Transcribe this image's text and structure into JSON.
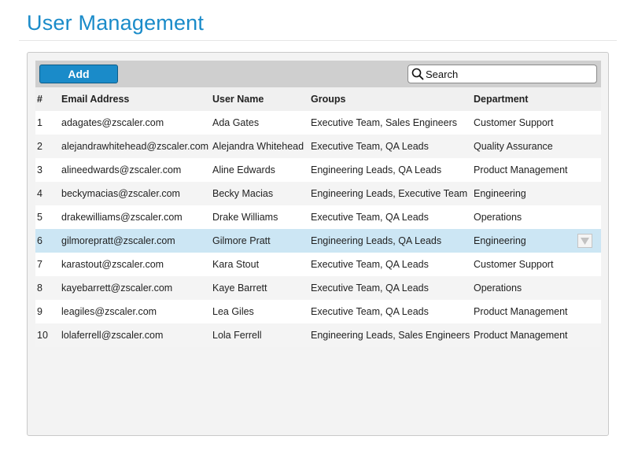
{
  "page": {
    "title": "User Management"
  },
  "toolbar": {
    "add_label": "Add",
    "search_placeholder": "Search"
  },
  "table": {
    "columns": [
      "#",
      "Email Address",
      "User Name",
      "Groups",
      "Department"
    ],
    "rows": [
      {
        "num": "1",
        "email": "adagates@zscaler.com",
        "name": "Ada Gates",
        "groups": "Executive Team, Sales Engineers",
        "department": "Customer Support"
      },
      {
        "num": "2",
        "email": "alejandrawhitehead@zscaler.com",
        "name": "Alejandra Whitehead",
        "groups": "Executive Team, QA Leads",
        "department": "Quality Assurance"
      },
      {
        "num": "3",
        "email": "alineedwards@zscaler.com",
        "name": "Aline Edwards",
        "groups": "Engineering Leads, QA Leads",
        "department": "Product Management"
      },
      {
        "num": "4",
        "email": "beckymacias@zscaler.com",
        "name": "Becky Macias",
        "groups": "Engineering Leads, Executive Team",
        "department": "Engineering"
      },
      {
        "num": "5",
        "email": "drakewilliams@zscaler.com",
        "name": "Drake Williams",
        "groups": "Executive Team, QA Leads",
        "department": "Operations"
      },
      {
        "num": "6",
        "email": "gilmorepratt@zscaler.com",
        "name": "Gilmore Pratt",
        "groups": "Engineering Leads, QA Leads",
        "department": "Engineering"
      },
      {
        "num": "7",
        "email": "karastout@zscaler.com",
        "name": "Kara Stout",
        "groups": "Executive Team, QA Leads",
        "department": "Customer Support"
      },
      {
        "num": "8",
        "email": "kayebarrett@zscaler.com",
        "name": "Kaye Barrett",
        "groups": "Executive Team, QA Leads",
        "department": "Operations"
      },
      {
        "num": "9",
        "email": "leagiles@zscaler.com",
        "name": "Lea Giles",
        "groups": "Executive Team, QA Leads",
        "department": "Product Management"
      },
      {
        "num": "10",
        "email": "lolaferrell@zscaler.com",
        "name": "Lola Ferrell",
        "groups": "Engineering Leads, Sales Engineers",
        "department": "Product Management"
      }
    ]
  },
  "colors": {
    "accent": "#1a8bc9",
    "selected_row": "#cce6f4"
  }
}
